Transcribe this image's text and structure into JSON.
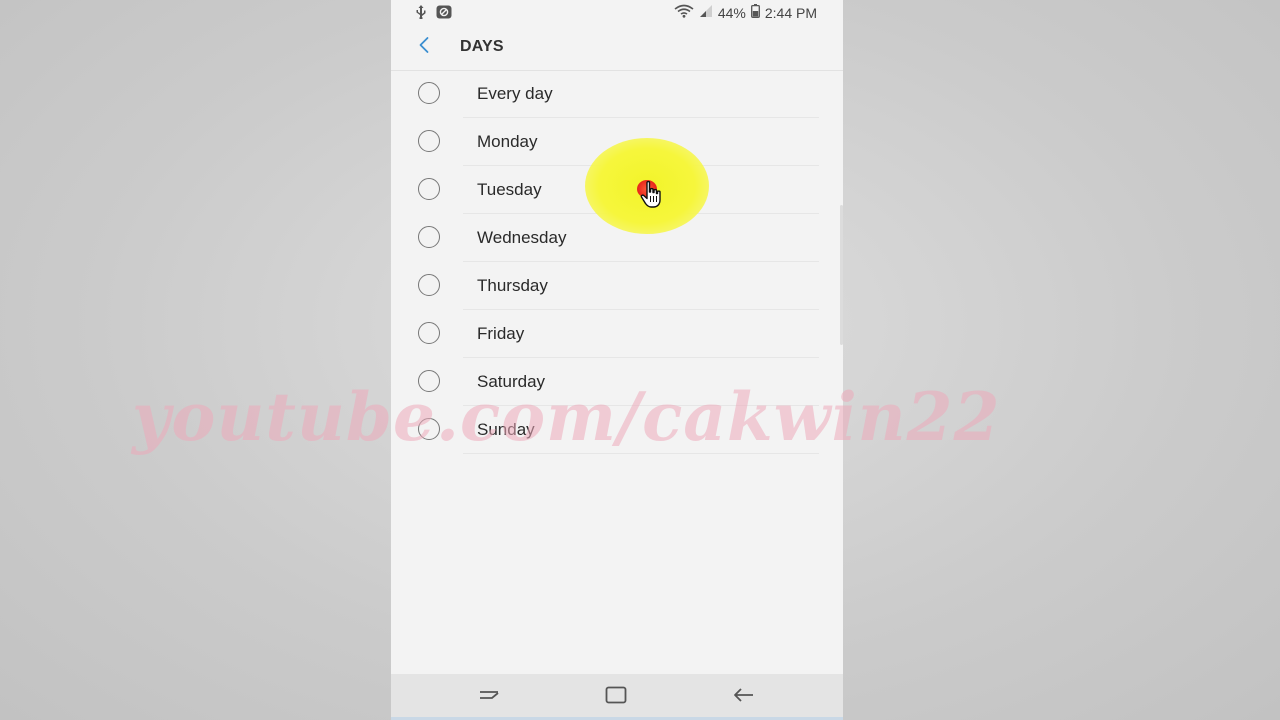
{
  "status_bar": {
    "battery_percent": "44%",
    "time": "2:44 PM"
  },
  "header": {
    "title": "DAYS"
  },
  "days": [
    {
      "label": "Every day",
      "selected": false
    },
    {
      "label": "Monday",
      "selected": false
    },
    {
      "label": "Tuesday",
      "selected": false
    },
    {
      "label": "Wednesday",
      "selected": false
    },
    {
      "label": "Thursday",
      "selected": false
    },
    {
      "label": "Friday",
      "selected": false
    },
    {
      "label": "Saturday",
      "selected": false
    },
    {
      "label": "Sunday",
      "selected": false
    }
  ],
  "watermark": {
    "text": "youtube.com/cakwin22"
  },
  "colors": {
    "accent": "#3b8ed0",
    "highlight": "#f4f43a",
    "click_dot": "#e8261a",
    "watermark": "#ecaaba"
  },
  "icons": {
    "back": "arrow-left-icon",
    "recents": "recent-apps-icon",
    "home": "home-icon",
    "nav_back": "back-icon"
  }
}
